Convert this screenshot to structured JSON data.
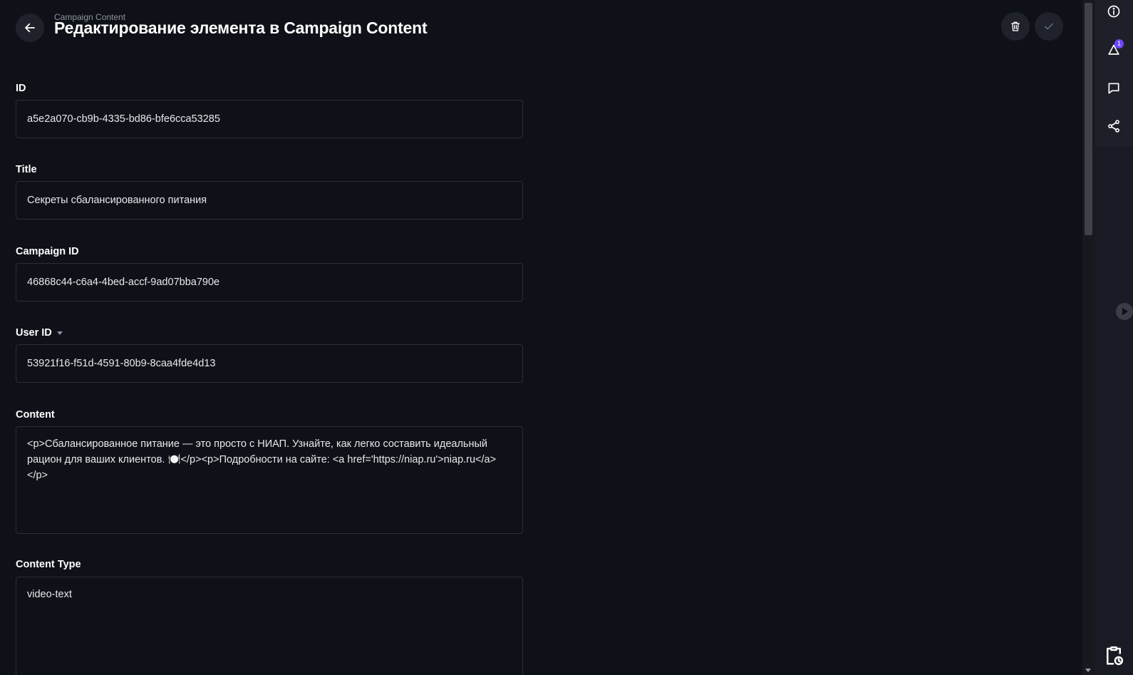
{
  "header": {
    "breadcrumb": "Campaign Content",
    "title": "Редактирование элемента в Campaign Content",
    "back_icon": "arrow-left-icon",
    "delete_icon": "trash-icon",
    "save_icon": "check-icon"
  },
  "fields": [
    {
      "label": "ID",
      "value": "a5e2a070-cb9b-4335-bd86-bfe6cca53285"
    },
    {
      "label": "Title",
      "value": "Секреты сбалансированного питания"
    },
    {
      "label": "Campaign ID",
      "value": "46868c44-c6a4-4bed-accf-9ad07bba790e"
    },
    {
      "label": "User ID",
      "value": "53921f16-f51d-4591-80b9-8caa4fde4d13"
    },
    {
      "label": "Content",
      "value": "<p>Сбалансированное питание — это просто с НИАП. Узнайте, как легко составить идеальный рацион для ваших клиентов. 🍽️</p><p>Подробности на сайте: <a href='https://niap.ru'>niap.ru</a></p>"
    },
    {
      "label": "Content Type",
      "value": "video-text"
    }
  ],
  "rail": {
    "notification_count": "1",
    "icons": [
      "info-icon",
      "notification-icon",
      "comment-icon",
      "share-icon",
      "play-icon",
      "clipboard-clock-icon"
    ]
  },
  "colors": {
    "background": "#0f1118",
    "rail": "#181b23",
    "badge": "#6c47ff",
    "input_border": "#2b2e38"
  }
}
